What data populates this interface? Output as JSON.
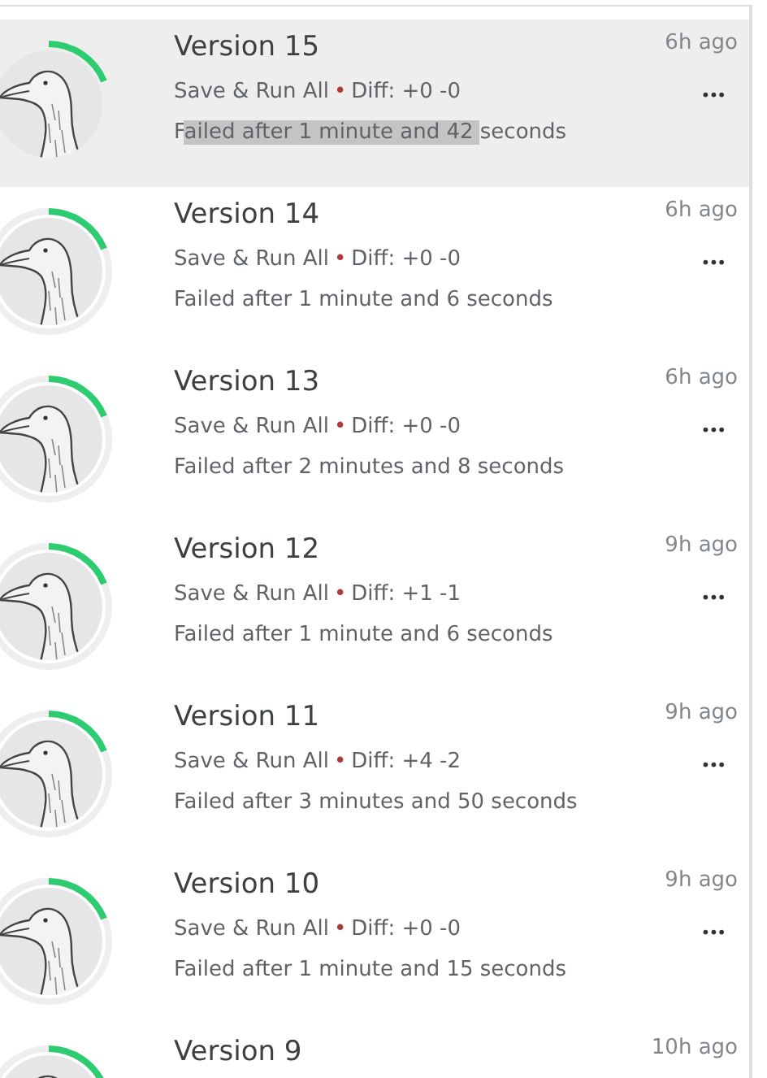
{
  "versions": [
    {
      "title": "Version 15",
      "time": "6h ago",
      "trigger": "Save & Run All",
      "separator": "•",
      "diff": "Diff: +0 -0",
      "status_parts": [
        {
          "text": "F",
          "selected": false
        },
        {
          "text": "ailed after 1 minute and 42 ",
          "selected": true
        },
        {
          "text": "seconds",
          "selected": false
        }
      ],
      "selected": true,
      "menu": "•••"
    },
    {
      "title": "Version 14",
      "time": "6h ago",
      "trigger": "Save & Run All",
      "separator": "•",
      "diff": "Diff: +0 -0",
      "status_parts": [
        {
          "text": "Failed after 1 minute and 6 seconds",
          "selected": false
        }
      ],
      "selected": false,
      "menu": "•••"
    },
    {
      "title": "Version 13",
      "time": "6h ago",
      "trigger": "Save & Run All",
      "separator": "•",
      "diff": "Diff: +0 -0",
      "status_parts": [
        {
          "text": "Failed after 2 minutes and 8 seconds",
          "selected": false
        }
      ],
      "selected": false,
      "menu": "•••"
    },
    {
      "title": "Version 12",
      "time": "9h ago",
      "trigger": "Save & Run All",
      "separator": "•",
      "diff": "Diff: +1 -1",
      "status_parts": [
        {
          "text": "Failed after 1 minute and 6 seconds",
          "selected": false
        }
      ],
      "selected": false,
      "menu": "•••"
    },
    {
      "title": "Version 11",
      "time": "9h ago",
      "trigger": "Save & Run All",
      "separator": "•",
      "diff": "Diff: +4 -2",
      "status_parts": [
        {
          "text": "Failed after 3 minutes and 50 seconds",
          "selected": false
        }
      ],
      "selected": false,
      "menu": "•••"
    },
    {
      "title": "Version 10",
      "time": "9h ago",
      "trigger": "Save & Run All",
      "separator": "•",
      "diff": "Diff: +0 -0",
      "status_parts": [
        {
          "text": "Failed after 1 minute and 15 seconds",
          "selected": false
        }
      ],
      "selected": false,
      "menu": "•••"
    },
    {
      "title": "Version 9",
      "time": "10h ago",
      "selected": false
    }
  ]
}
